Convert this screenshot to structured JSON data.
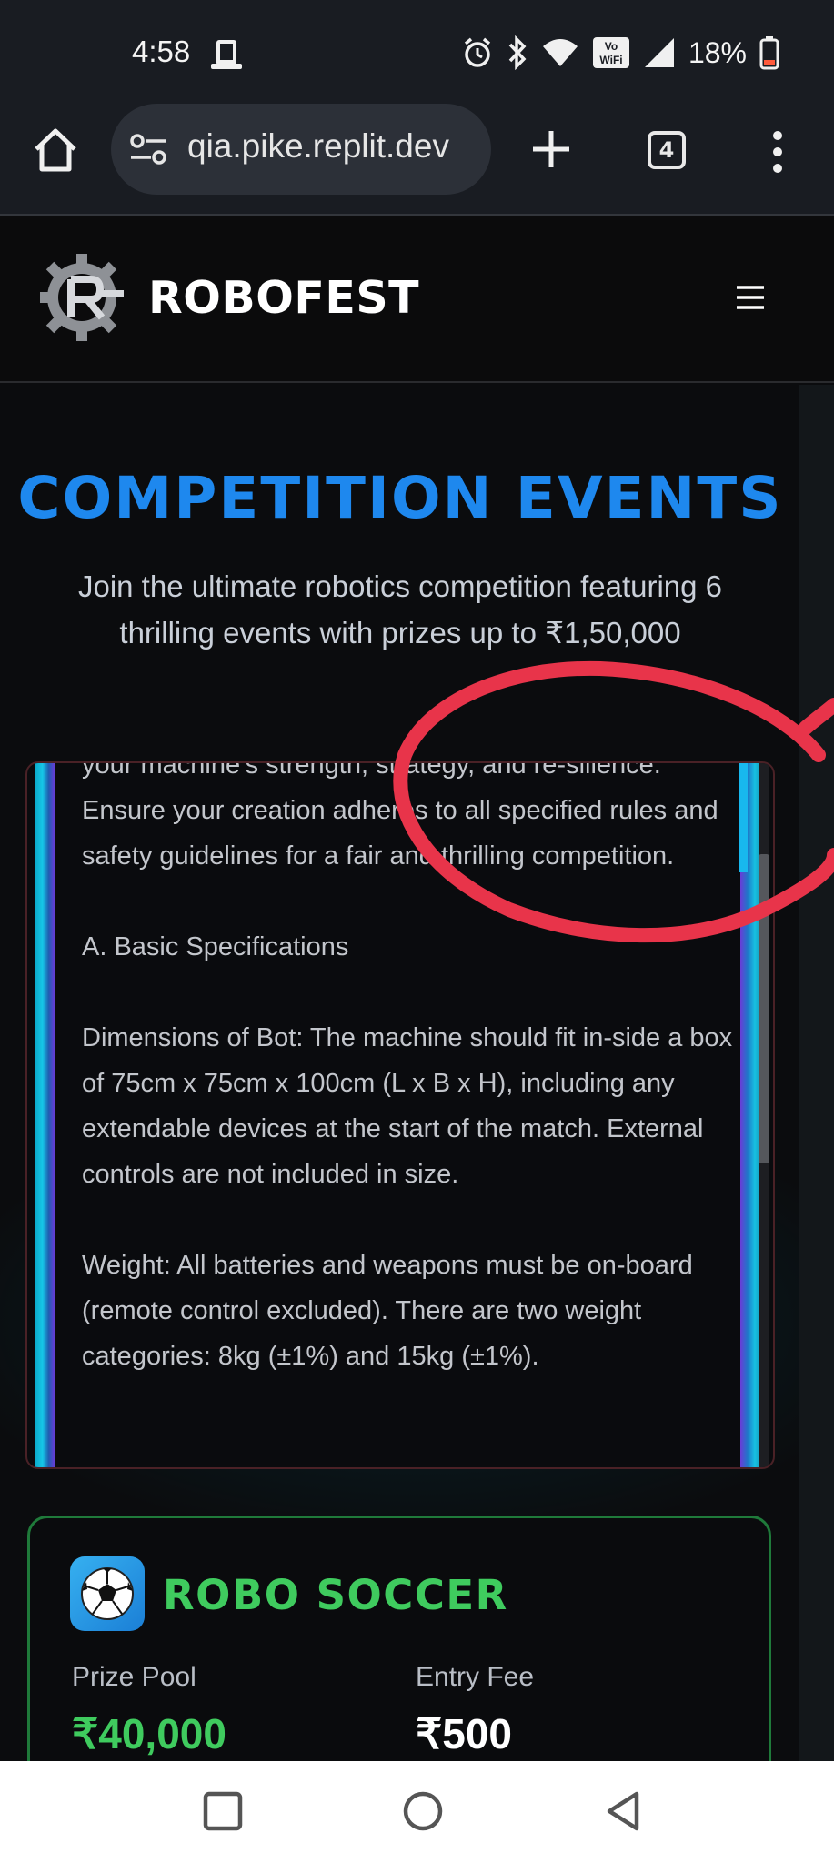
{
  "status_bar": {
    "time": "4:58",
    "battery_percent": "18%",
    "icons": [
      "phone-link-icon",
      "alarm-icon",
      "bluetooth-icon",
      "wifi-icon",
      "vowifi-icon",
      "signal-icon",
      "battery-icon"
    ]
  },
  "browser": {
    "url": "qia.pike.replit.dev",
    "tab_count": "4"
  },
  "site": {
    "brand": "ROBOFEST"
  },
  "main": {
    "heading": "COMPETITION EVENTS",
    "subtitle": "Join the ultimate robotics competition featuring 6 thrilling events with prizes up to ₹1,50,000",
    "rules_paragraphs": [
      "your machine's strength, strategy, and re-silience. Ensure your creation adheres to all specified rules and safety guidelines for a fair and thrilling competition.",
      "A. Basic Specifications",
      "Dimensions of Bot: The machine should fit in-side a box of 75cm x 75cm x 100cm (L x B x H), including any extendable devices at the start of the match. External controls are not included in size.",
      "Weight: All batteries and weapons must be on-board (remote control excluded). There are two weight categories: 8kg (±1%) and 15kg (±1%)."
    ]
  },
  "event_card": {
    "icon": "soccer-ball-icon",
    "title": "ROBO SOCCER",
    "prize_label": "Prize Pool",
    "prize_value": "₹40,000",
    "fee_label": "Entry Fee",
    "fee_value": "₹500"
  },
  "colors": {
    "heading_blue": "#1e88ee",
    "accent_green": "#3fcb5e",
    "annotation_red": "#e8344a",
    "background": "#0b0c0e"
  }
}
